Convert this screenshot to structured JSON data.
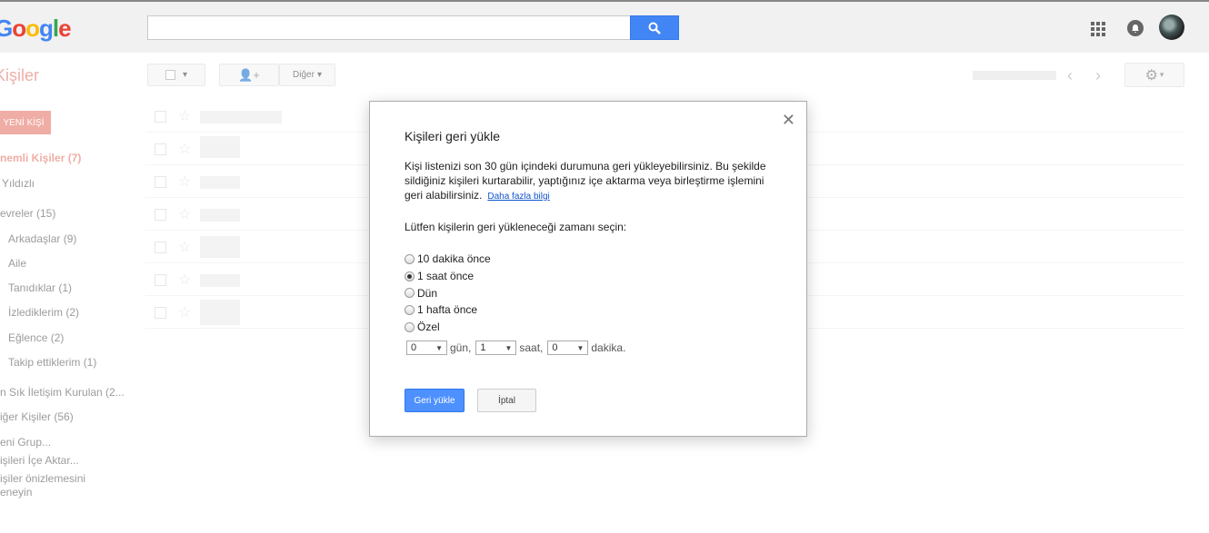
{
  "header": {
    "logo_text": "Google",
    "search": {
      "placeholder": "",
      "value": ""
    },
    "icons": {
      "search": "search-icon",
      "apps": "apps-grid-icon",
      "notifications": "bell-icon",
      "avatar": "user-avatar"
    }
  },
  "app": {
    "title": "Kişiler"
  },
  "toolbar": {
    "more_label": "Diğer"
  },
  "sidebar": {
    "new_contact_label": "YENİ KİŞİ",
    "items": [
      {
        "label": "nemli Kişiler (7)",
        "active": true
      },
      {
        "label": "Yıldızlı"
      },
      {
        "label": "evreler (15)"
      },
      {
        "label": "Arkadaşlar (9)"
      },
      {
        "label": "Aile"
      },
      {
        "label": "Tanıdıklar (1)"
      },
      {
        "label": "İzlediklerim (2)"
      },
      {
        "label": "Eğlence (2)"
      },
      {
        "label": "Takip ettiklerim (1)"
      },
      {
        "label": "n Sık İletişim Kurulan (2..."
      },
      {
        "label": "iğer Kişiler (56)"
      },
      {
        "label": "eni Grup..."
      },
      {
        "label": "işileri İçe Aktar..."
      },
      {
        "label": "işiler önizlemesini"
      },
      {
        "label": "eneyin"
      }
    ]
  },
  "dialog": {
    "title": "Kişileri geri yükle",
    "description": "Kişi listenizi son 30 gün içindeki durumuna geri yükleyebilirsiniz. Bu şekilde sildiğiniz kişileri kurtarabilir, yaptığınız içe aktarma veya birleştirme işlemini geri alabilirsiniz.",
    "learn_more": "Daha fazla bilgi",
    "prompt": "Lütfen kişilerin geri yükleneceği zamanı seçin:",
    "options": [
      {
        "label": "10 dakika önce",
        "checked": false
      },
      {
        "label": "1 saat önce",
        "checked": true
      },
      {
        "label": "Dün",
        "checked": false
      },
      {
        "label": "1 hafta önce",
        "checked": false
      },
      {
        "label": "Özel",
        "checked": false
      }
    ],
    "custom": {
      "days_value": "0",
      "days_unit": "gün,",
      "hours_value": "1",
      "hours_unit": "saat,",
      "minutes_value": "0",
      "minutes_unit": "dakika."
    },
    "restore_label": "Geri yükle",
    "cancel_label": "İptal"
  }
}
